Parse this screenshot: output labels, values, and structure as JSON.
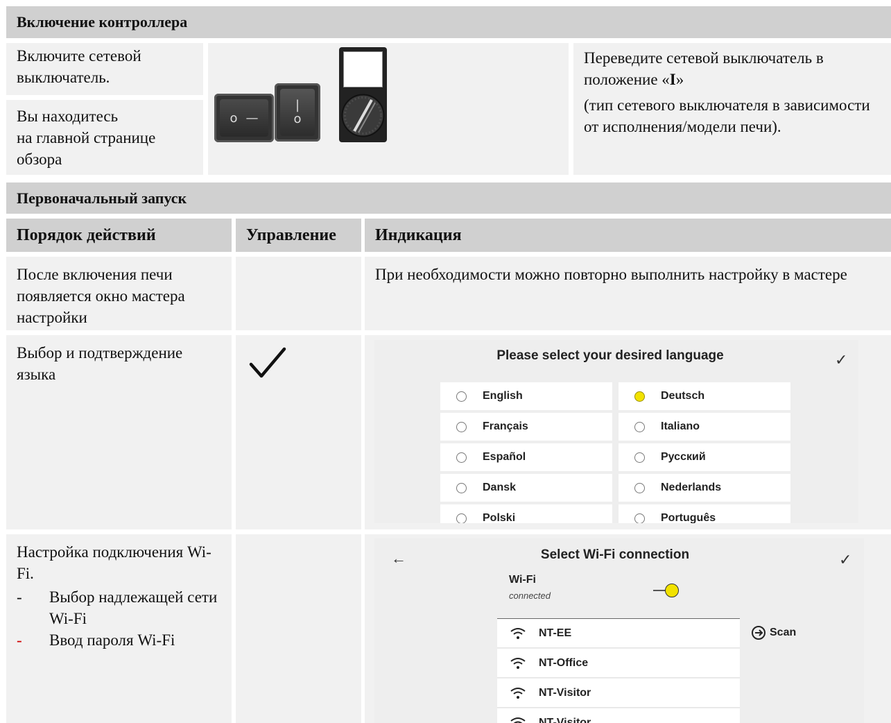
{
  "section1": {
    "title": "Включение контроллера",
    "left_step1": "Включите сетевой выключатель.",
    "left_step2_l1": "Вы находитесь",
    "left_step2_l2": "на главной странице обзора",
    "right_l1": "Переведите сетевой выключатель в положение «",
    "right_l1_bold": "I",
    "right_l1_end": "»",
    "right_l2": "(тип сетевого выключателя в зависимости от исполнения/модели печи).",
    "switch1": {
      "left_symbol": "o",
      "right_symbol": "—"
    },
    "switch2": {
      "top_symbol": "|",
      "bottom_symbol": "o"
    }
  },
  "section2": {
    "title": "Первоначальный запуск",
    "columns": [
      "Порядок действий",
      "Управление",
      "Индикация"
    ],
    "row1": {
      "action": "После включения печи появляется окно мастера настройки",
      "indication": "При необходимости можно повторно выполнить настройку в мастере"
    },
    "row2": {
      "action": "Выбор и подтверждение языка"
    },
    "row3": {
      "action": "Настройка подключения Wi-Fi.",
      "bullets": [
        "Выбор надлежащей сети Wi-Fi",
        "Ввод пароля Wi-Fi"
      ],
      "bullet_mark": "-"
    }
  },
  "language_screen": {
    "title": "Please select your desired language",
    "confirm_glyph": "✓",
    "left_column": [
      "English",
      "Français",
      "Español",
      "Dansk",
      "Polski"
    ],
    "right_column": [
      "Deutsch",
      "Italiano",
      "Русский",
      "Nederlands",
      "Português"
    ],
    "selected": "Deutsch",
    "selected_color": "#f2e200"
  },
  "wifi_screen": {
    "title": "Select Wi-Fi connection",
    "back_glyph": "←",
    "confirm_glyph": "✓",
    "wifi_label": "Wi-Fi",
    "wifi_status": "connected",
    "scan_label": "Scan",
    "networks": [
      "NT-EE",
      "NT-Office",
      "NT-Visitor",
      "NT-Visitor"
    ],
    "toggle_color": "#f2e200"
  },
  "colors": {
    "header_bg": "#d0d0d0",
    "cell_bg": "#f1f1f1",
    "bullet_red": "#d00000"
  }
}
